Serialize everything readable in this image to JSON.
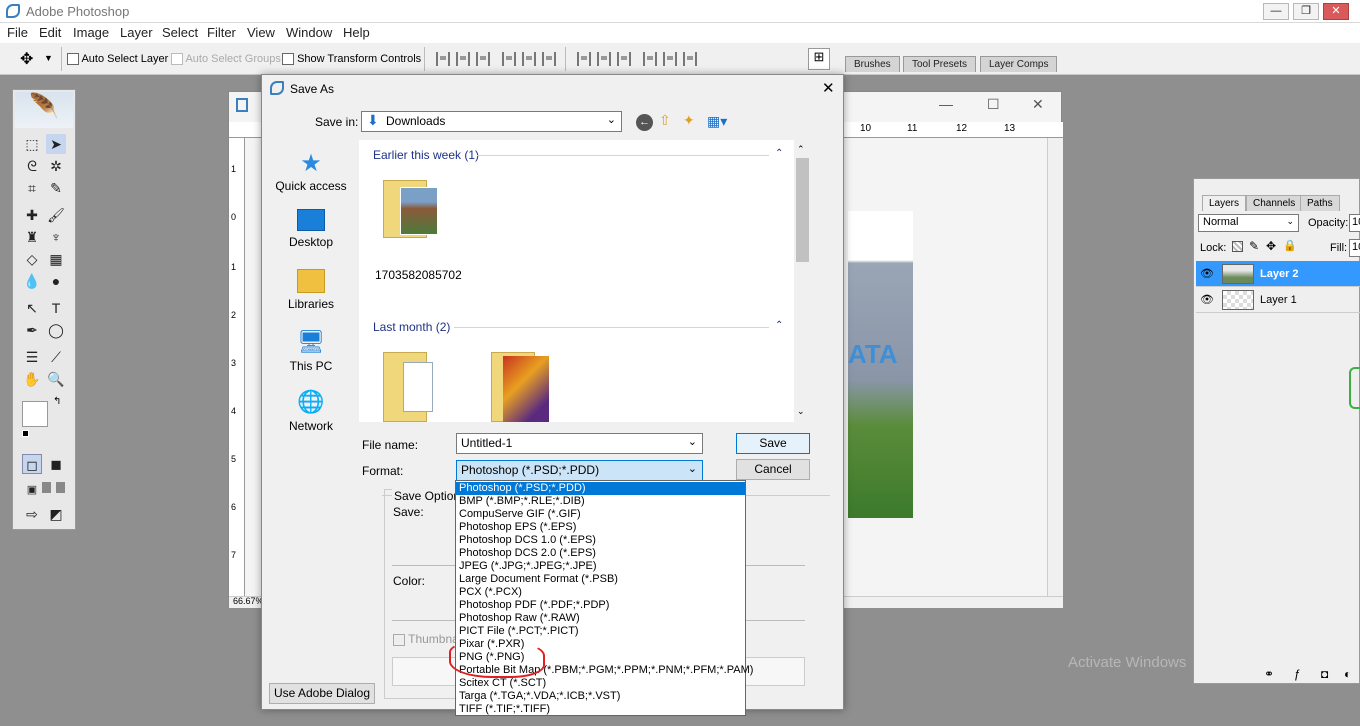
{
  "app": {
    "title": "Adobe Photoshop",
    "window_controls": {
      "minimize": "—",
      "restore": "❐",
      "close": "✕"
    }
  },
  "menu": [
    "File",
    "Edit",
    "Image",
    "Layer",
    "Select",
    "Filter",
    "View",
    "Window",
    "Help"
  ],
  "options_bar": {
    "auto_select_layer": "Auto Select Layer",
    "auto_select_groups": "Auto Select Groups",
    "show_transform_controls": "Show Transform Controls"
  },
  "palette_tabs": [
    "Brushes",
    "Tool Presets",
    "Layer Comps"
  ],
  "document": {
    "zoom": "66.67%",
    "ruler_marks": [
      "10",
      "11",
      "12",
      "13"
    ],
    "vruler_marks": [
      "1",
      "0",
      "1",
      "2",
      "3",
      "4",
      "5",
      "6",
      "7"
    ],
    "canvas_text": "ATA"
  },
  "layers_panel": {
    "tabs": [
      "Layers",
      "Channels",
      "Paths"
    ],
    "blend_mode": "Normal",
    "opacity_label": "Opacity:",
    "opacity_value": "10",
    "lock_label": "Lock:",
    "fill_label": "Fill:",
    "fill_value": "10",
    "layers": [
      {
        "name": "Layer 2",
        "selected": true
      },
      {
        "name": "Layer 1",
        "selected": false
      }
    ]
  },
  "dialog": {
    "title": "Save As",
    "save_in_label": "Save in:",
    "save_in_value": "Downloads",
    "places": [
      "Quick access",
      "Desktop",
      "Libraries",
      "This PC",
      "Network"
    ],
    "groups": [
      {
        "label": "Earlier this week (1)",
        "files": [
          "1703582085702"
        ]
      },
      {
        "label": "Last month (2)",
        "files": [
          "",
          ""
        ]
      }
    ],
    "file_name_label": "File name:",
    "file_name_value": "Untitled-1",
    "format_label": "Format:",
    "format_value": "Photoshop (*.PSD;*.PDD)",
    "save_button": "Save",
    "cancel_button": "Cancel",
    "save_options": "Save Options",
    "save_label": "Save:",
    "color_label": "Color:",
    "thumbnail_label": "Thumbnail",
    "use_adobe_dialog": "Use Adobe Dialog",
    "format_options": [
      "Photoshop (*.PSD;*.PDD)",
      "BMP (*.BMP;*.RLE;*.DIB)",
      "CompuServe GIF (*.GIF)",
      "Photoshop EPS (*.EPS)",
      "Photoshop DCS 1.0 (*.EPS)",
      "Photoshop DCS 2.0 (*.EPS)",
      "JPEG (*.JPG;*.JPEG;*.JPE)",
      "Large Document Format (*.PSB)",
      "PCX (*.PCX)",
      "Photoshop PDF (*.PDF;*.PDP)",
      "Photoshop Raw (*.RAW)",
      "PICT File (*.PCT;*.PICT)",
      "Pixar (*.PXR)",
      "PNG (*.PNG)",
      "Portable Bit Map (*.PBM;*.PGM;*.PPM;*.PNM;*.PFM;*.PAM)",
      "Scitex CT (*.SCT)",
      "Targa (*.TGA;*.VDA;*.ICB;*.VST)",
      "TIFF (*.TIF;*.TIFF)"
    ]
  },
  "watermark": "Activate Windows",
  "colors": {
    "accent": "#0078d7",
    "highlight_red": "#e02020",
    "group_blue": "#1e3287"
  }
}
